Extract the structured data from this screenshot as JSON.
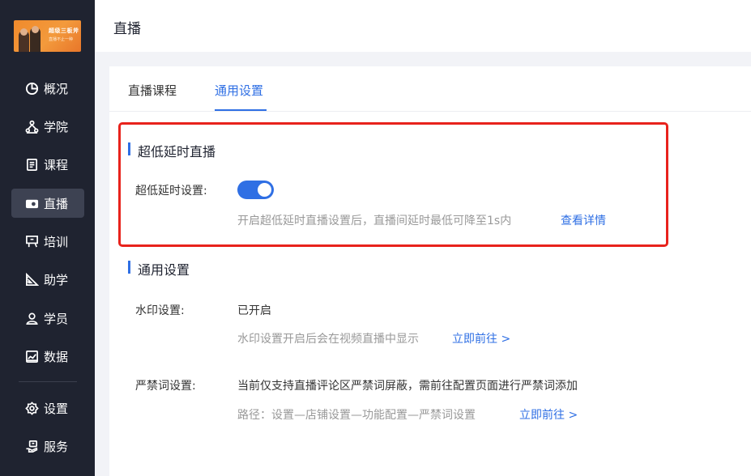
{
  "logo": {
    "line1": "超级三板斧",
    "line2": "直播不止一种",
    "colors": {
      "bg": "#f08a2c"
    }
  },
  "sidebar": {
    "items": [
      {
        "label": "概况",
        "icon": "pie-chart-icon"
      },
      {
        "label": "学院",
        "icon": "org-tree-icon"
      },
      {
        "label": "课程",
        "icon": "document-icon"
      },
      {
        "label": "直播",
        "icon": "video-camera-icon",
        "active": true
      },
      {
        "label": "培训",
        "icon": "presentation-icon"
      },
      {
        "label": "助学",
        "icon": "ruler-triangle-icon"
      },
      {
        "label": "学员",
        "icon": "user-icon"
      },
      {
        "label": "数据",
        "icon": "chart-frame-icon"
      },
      {
        "label": "设置",
        "icon": "gear-icon"
      },
      {
        "label": "服务",
        "icon": "service-hand-icon"
      }
    ]
  },
  "header": {
    "title": "直播"
  },
  "tabs": [
    {
      "label": "直播课程"
    },
    {
      "label": "通用设置",
      "active": true
    }
  ],
  "ultra_low_latency": {
    "title": "超低延时直播",
    "setting_label": "超低延时设置:",
    "enabled": true,
    "hint": "开启超低延时直播设置后，直播间延时最低可降至1s内",
    "link": "查看详情"
  },
  "general": {
    "title": "通用设置",
    "watermark": {
      "label": "水印设置:",
      "value": "已开启",
      "hint": "水印设置开启后会在视频直播中显示",
      "link": "立即前往 >"
    },
    "banned_words": {
      "label": "严禁词设置:",
      "value": "当前仅支持直播评论区严禁词屏蔽，需前往配置页面进行严禁词添加",
      "hint": "路径：设置—店铺设置—功能配置—严禁词设置",
      "link": "立即前往 >"
    }
  },
  "colors": {
    "accent": "#2f6fe4",
    "sidebar_bg": "#1f2330",
    "highlight_border": "#e8221c"
  }
}
